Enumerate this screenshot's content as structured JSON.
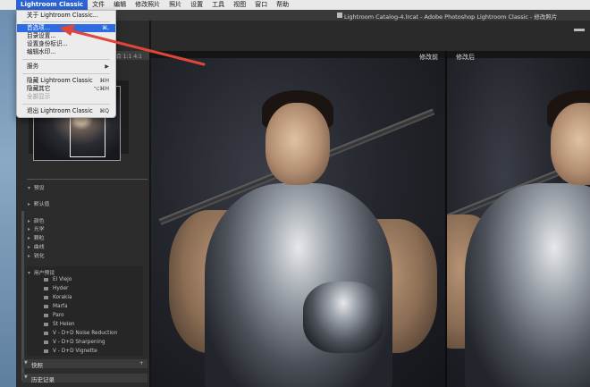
{
  "menubar": {
    "items": [
      "Lightroom Classic",
      "文件",
      "编辑",
      "修改照片",
      "照片",
      "设置",
      "工具",
      "视图",
      "窗口",
      "帮助"
    ]
  },
  "window": {
    "title": "Lightroom Catalog-4.lrcat - Adobe Photoshop Lightroom Classic - 修改照片"
  },
  "app_menu": {
    "items": [
      {
        "label": "关于 Lightroom Classic...",
        "shortcut": ""
      },
      {
        "label": "首选项...",
        "shortcut": "⌘,"
      },
      {
        "label": "目录设置...",
        "shortcut": ""
      },
      {
        "label": "设置身份标识...",
        "shortcut": ""
      },
      {
        "label": "编辑水印...",
        "shortcut": ""
      },
      {
        "label": "服务",
        "shortcut": "▶"
      },
      {
        "label": "隐藏 Lightroom Classic",
        "shortcut": "⌘H"
      },
      {
        "label": "隐藏其它",
        "shortcut": "⌥⌘H"
      },
      {
        "label": "全部显示",
        "shortcut": ""
      },
      {
        "label": "退出 Lightroom Classic",
        "shortcut": "⌘Q"
      }
    ]
  },
  "left_panel": {
    "nav_zoom": "适合   1:1   4:1",
    "presets_header": "预设",
    "preset_groups": [
      "默认值",
      "颜色",
      "光学",
      "颗粒",
      "曲线",
      "锐化"
    ],
    "user_presets_group": "用户预设",
    "user_presets": [
      "El Viejo",
      "Hyder",
      "Korakia",
      "Marfa",
      "Paro",
      "St Helen",
      "V - D+D Noise Reduction",
      "V - D+D Sharpening",
      "V - D+D Vignette"
    ],
    "snapshots_label": "快照",
    "history_label": "历史记录"
  },
  "main": {
    "label_before": "修改前",
    "label_after": "修改后"
  },
  "colors": {
    "menu_highlight": "#2c6be0",
    "arrow": "#e0453a"
  }
}
